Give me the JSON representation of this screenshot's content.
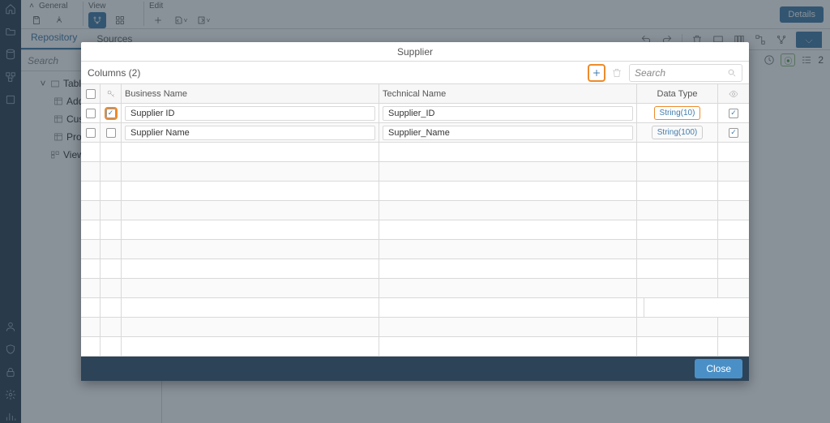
{
  "topbar": {
    "group_general": "General",
    "group_view": "View",
    "group_edit": "Edit",
    "details": "Details"
  },
  "tabs": {
    "repo": "Repository",
    "sources": "Sources"
  },
  "search_placeholder": "Search",
  "tree": {
    "tables": "Tables",
    "addr": "Addr…",
    "cust": "Cust…",
    "prod": "Prod…",
    "views": "Views"
  },
  "right": {
    "count": "2"
  },
  "modal": {
    "title": "Supplier",
    "columns_label": "Columns (2)",
    "search_placeholder": "Search",
    "headers": {
      "business": "Business Name",
      "technical": "Technical Name",
      "datatype": "Data Type"
    },
    "rows": [
      {
        "bn": "Supplier ID",
        "tn": "Supplier_ID",
        "dt": "String(10)",
        "key": true,
        "dt_hl": true
      },
      {
        "bn": "Supplier Name",
        "tn": "Supplier_Name",
        "dt": "String(100)",
        "key": false,
        "dt_hl": false
      }
    ],
    "close": "Close"
  }
}
